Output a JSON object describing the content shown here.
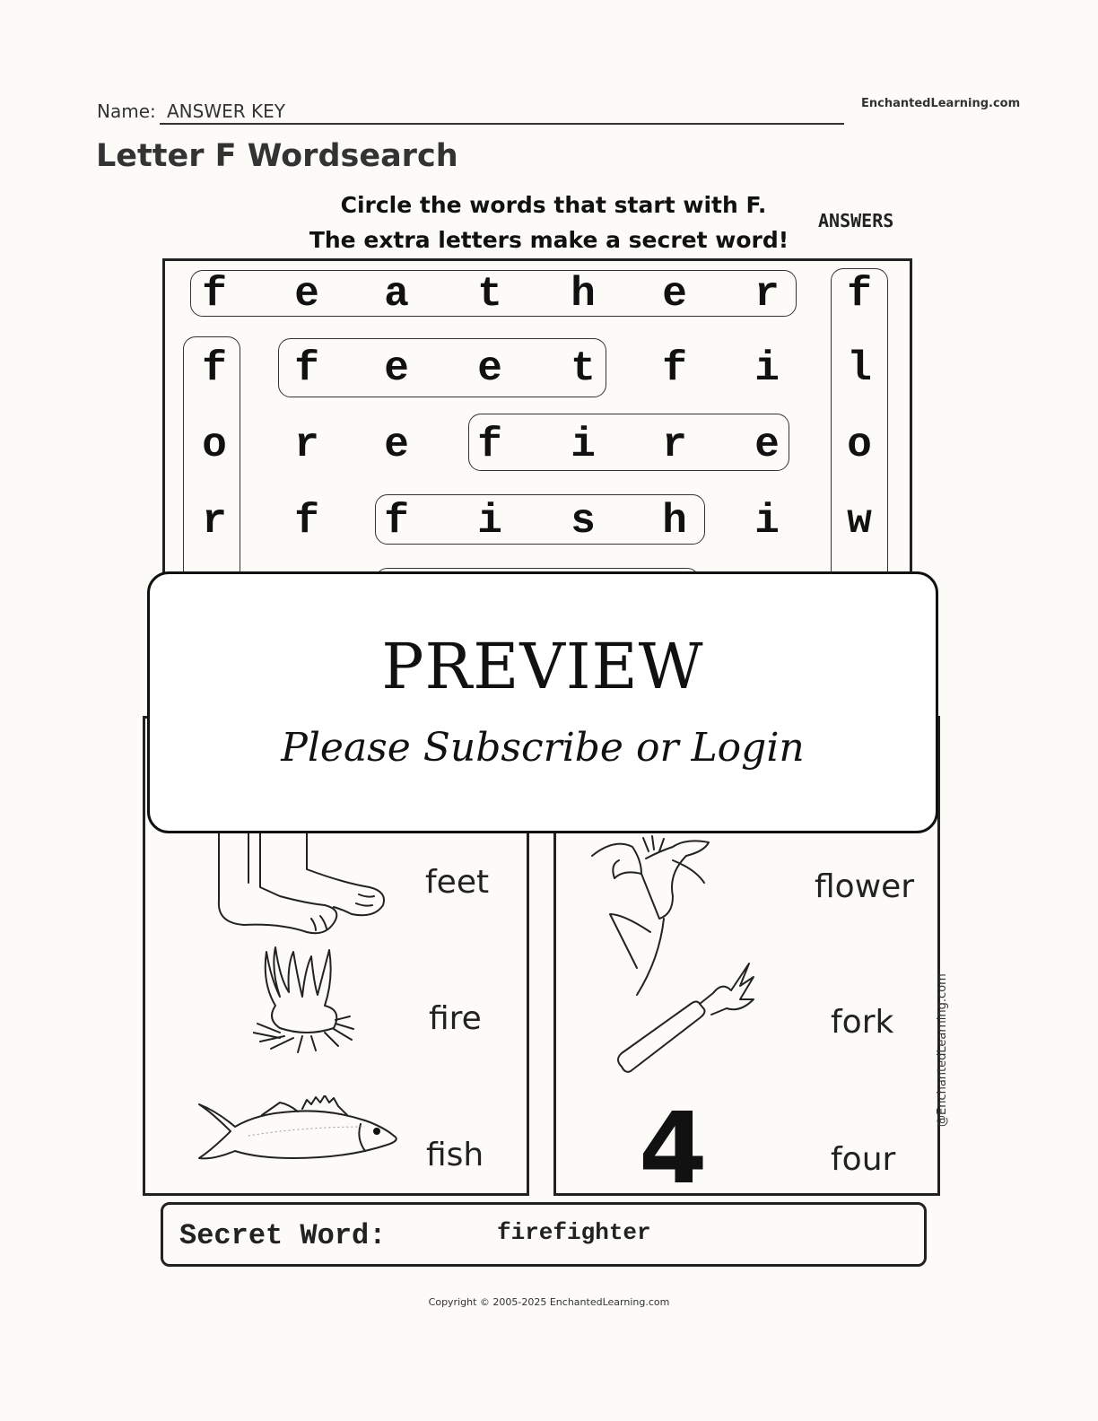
{
  "header": {
    "name_label": "Name:",
    "name_value": "ANSWER KEY",
    "brand": "EnchantedLearning.com",
    "title": "Letter F Wordsearch"
  },
  "instructions": {
    "line1": "Circle the words that start with F.",
    "line2": "The extra letters make a secret word!",
    "answers_label": "ANSWERS"
  },
  "grid": {
    "rows": [
      [
        "f",
        "e",
        "a",
        "t",
        "h",
        "e",
        "r",
        "f"
      ],
      [
        "f",
        "f",
        "e",
        "e",
        "t",
        "f",
        "i",
        "l"
      ],
      [
        "o",
        "r",
        "e",
        "f",
        "i",
        "r",
        "e",
        "o"
      ],
      [
        "r",
        "f",
        "f",
        "i",
        "s",
        "h",
        "i",
        "w"
      ]
    ],
    "found_words": [
      "feather",
      "feet",
      "fire",
      "fish",
      "for",
      "flow"
    ]
  },
  "preview": {
    "title": "PREVIEW",
    "subtitle": "Please Subscribe or Login"
  },
  "picture_words": {
    "left": [
      "feet",
      "fire",
      "fish"
    ],
    "right": [
      "flower",
      "fork",
      "four"
    ],
    "four_glyph": "4",
    "credit": "@EnchantedLearning.com"
  },
  "secret": {
    "label": "Secret Word:",
    "value": "firefighter"
  },
  "footer": {
    "copyright": "Copyright © 2005-2025 EnchantedLearning.com"
  }
}
